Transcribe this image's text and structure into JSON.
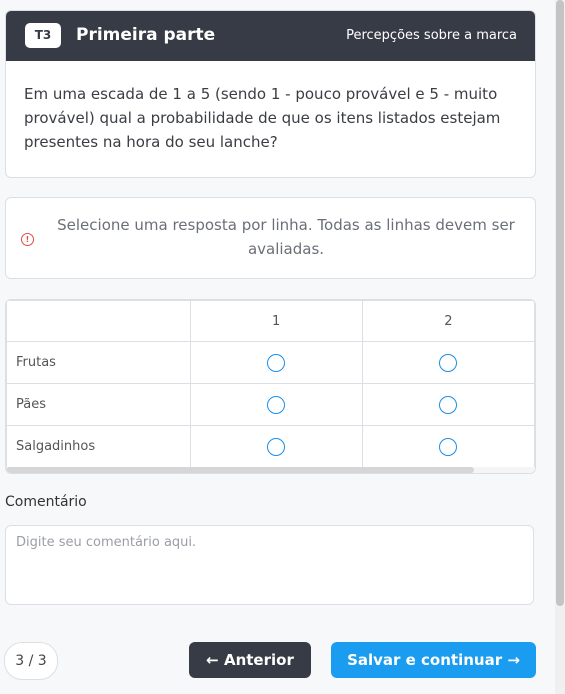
{
  "header": {
    "badge": "T3",
    "title": "Primeira parte",
    "subtitle": "Percepções sobre a marca"
  },
  "question": "Em uma escada de 1 a 5 (sendo 1 - pouco provável e 5 - muito provável) qual a probabilidade de que os itens listados estejam presentes na hora do seu lanche?",
  "alert": {
    "icon": "alert-circle-icon",
    "text": "Selecione uma resposta por linha. Todas as linhas devem ser avaliadas."
  },
  "grid": {
    "columns": [
      "1",
      "2"
    ],
    "rows": [
      "Frutas",
      "Pães",
      "Salgadinhos"
    ]
  },
  "comment": {
    "label": "Comentário",
    "placeholder": "Digite seu comentário aqui.",
    "value": ""
  },
  "footer": {
    "page": "3 / 3",
    "prev_label": "Anterior",
    "next_label": "Salvar e continuar",
    "prev_icon": "arrow-left-icon",
    "next_icon": "arrow-right-icon"
  },
  "colors": {
    "header_bg": "#373b45",
    "accent": "#1a9cf0",
    "alert": "#e04b4b"
  }
}
